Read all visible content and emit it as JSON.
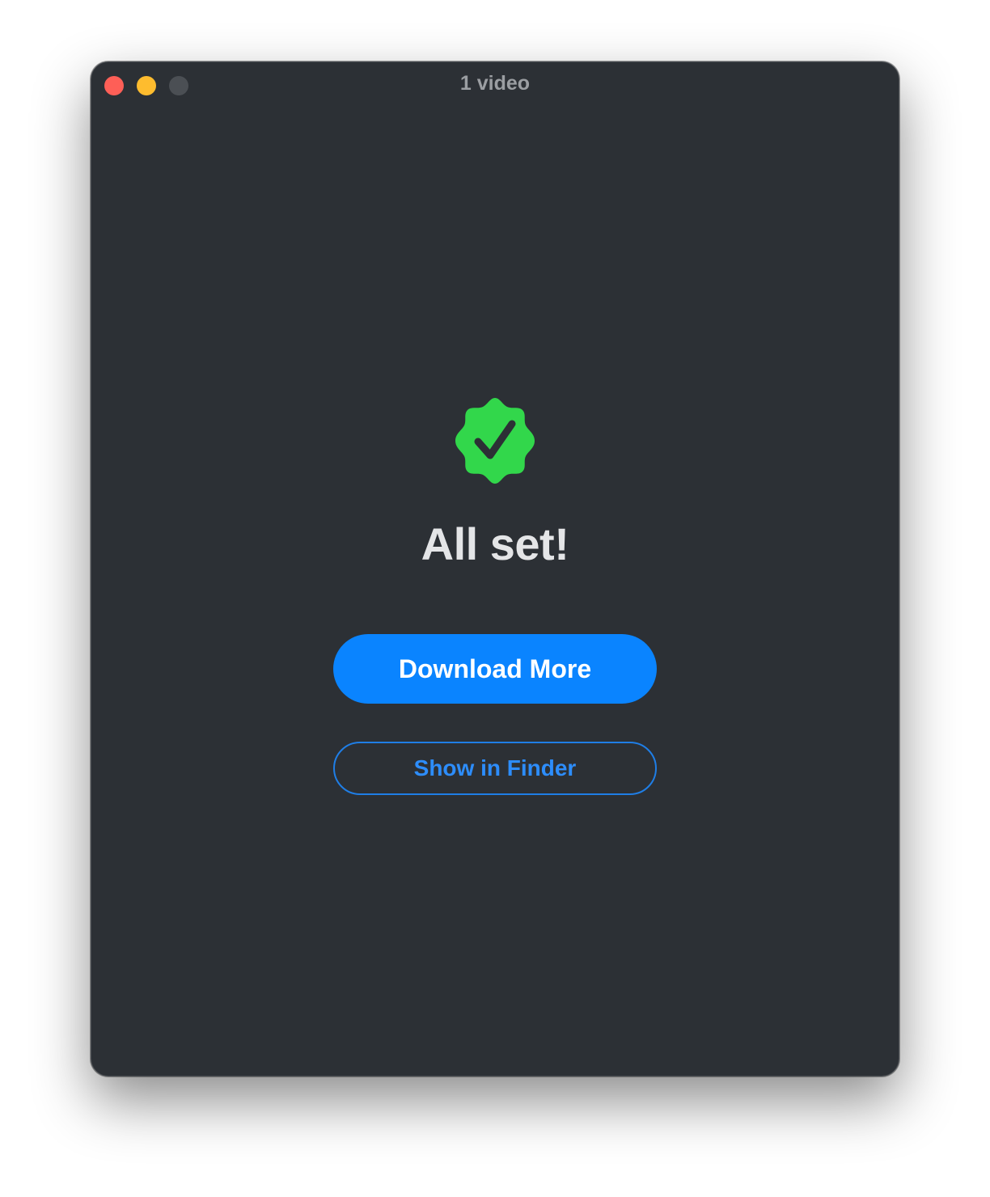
{
  "window": {
    "title": "1 video",
    "background": "#2c3035"
  },
  "traffic_lights": {
    "close_color": "#fe5f57",
    "minimize_color": "#febc2e",
    "zoom_color": "#4b4f54"
  },
  "status": {
    "icon": "checkmark-seal-icon",
    "icon_color": "#32d74b",
    "heading": "All set!"
  },
  "actions": {
    "primary_label": "Download More",
    "primary_color": "#0a84ff",
    "secondary_label": "Show in Finder",
    "secondary_color": "#2d8dfb"
  }
}
